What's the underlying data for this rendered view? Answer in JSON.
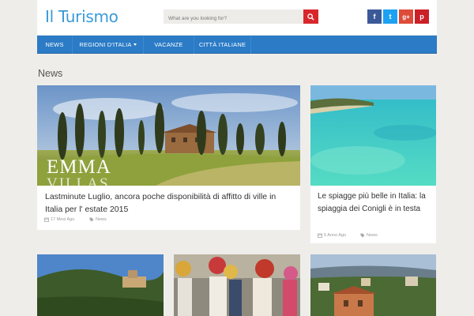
{
  "header": {
    "logo": "Il Turismo",
    "search_placeholder": "What are you looking for?"
  },
  "social": [
    {
      "icon": "facebook-icon",
      "label": "f",
      "color": "#3b5998"
    },
    {
      "icon": "twitter-icon",
      "label": "t",
      "color": "#1da1f2"
    },
    {
      "icon": "google-plus-icon",
      "label": "g+",
      "color": "#dd4b39"
    },
    {
      "icon": "pinterest-icon",
      "label": "p",
      "color": "#cb2027"
    }
  ],
  "nav": {
    "items": [
      "NEWS",
      "REGIONI D'ITALIA",
      "VACANZE",
      "CITTÀ ITALIANE"
    ]
  },
  "section": {
    "title": "News"
  },
  "posts": [
    {
      "title": "Lastminute Luglio, ancora poche disponibilità di affitto di ville in Italia per l' estate 2015",
      "date": "17 Mesi Ago",
      "category": "News",
      "image_overlay_1": "EMMA",
      "image_overlay_2": "VILLAS"
    },
    {
      "title": "Le spiagge più belle in Italia: la spiaggia dei Conigli è in testa",
      "date": "5 Anno Ago",
      "category": "News"
    }
  ],
  "colors": {
    "accent": "#2b7bc6",
    "logo": "#3a9ad9",
    "search_button": "#d7272c",
    "background": "#efedea"
  }
}
